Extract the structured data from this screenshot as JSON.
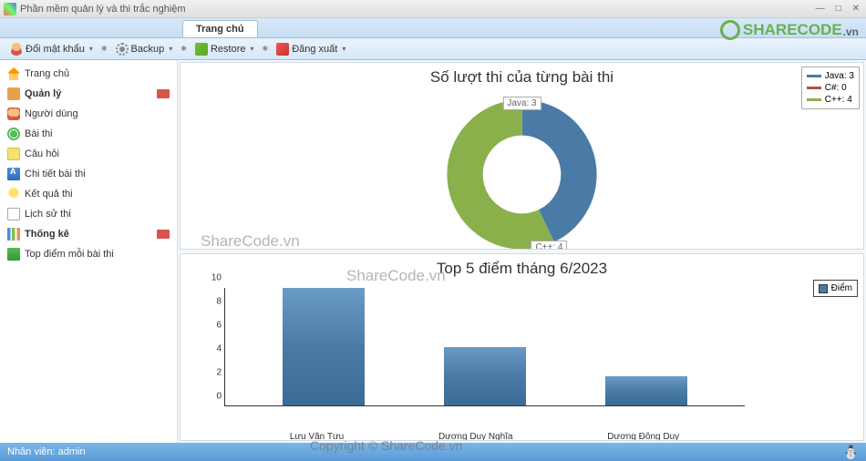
{
  "app_title": "Phần mềm quản lý và thi trắc nghiệm",
  "active_tab": "Trang chủ",
  "toolbar": {
    "change_pw": "Đổi mật khẩu",
    "backup": "Backup",
    "restore": "Restore",
    "logout": "Đăng xuất"
  },
  "sidebar": {
    "items": [
      {
        "label": "Trang chủ"
      },
      {
        "label": "Quản lý",
        "badge": true,
        "bold": true
      },
      {
        "label": "Người dùng"
      },
      {
        "label": "Bài thi"
      },
      {
        "label": "Câu hỏi"
      },
      {
        "label": "Chi tiết bài thi"
      },
      {
        "label": "Kết quả thi"
      },
      {
        "label": "Lịch sử thi"
      },
      {
        "label": "Thống kê",
        "badge": true,
        "bold": true
      },
      {
        "label": "Top điểm mỗi bài thi"
      }
    ]
  },
  "donut": {
    "title": "Số lượt thi của từng bài thi",
    "label_top": "Java: 3",
    "label_bot": "C++: 4",
    "legend": [
      {
        "name": "Java: 3",
        "color": "#4a7ba6"
      },
      {
        "name": "C#: 0",
        "color": "#b05050"
      },
      {
        "name": "C++: 4",
        "color": "#8ab04c"
      }
    ]
  },
  "bar": {
    "title": "Top 5 điểm tháng 6/2023",
    "legend_label": "Điểm",
    "y_ticks": [
      "0",
      "2",
      "4",
      "6",
      "8",
      "10"
    ]
  },
  "chart_data": [
    {
      "type": "pie",
      "title": "Số lượt thi của từng bài thi",
      "categories": [
        "Java",
        "C#",
        "C++"
      ],
      "values": [
        3,
        0,
        4
      ],
      "colors": [
        "#4a7ba6",
        "#b05050",
        "#8ab04c"
      ]
    },
    {
      "type": "bar",
      "title": "Top 5 điểm tháng 6/2023",
      "categories": [
        "Lưu Văn Tưu",
        "Dương Duy Nghĩa",
        "Dương Đông Duy"
      ],
      "values": [
        10,
        5,
        2.5
      ],
      "series_name": "Điểm",
      "ylim": [
        0,
        10
      ],
      "ylabel": "",
      "xlabel": ""
    }
  ],
  "status": "Nhân viên: admin",
  "watermarks": {
    "w1": "ShareCode.vn",
    "w2": "ShareCode.vn",
    "w3": "Copyright © ShareCode.vn"
  },
  "logo": {
    "t1": "SHARECODE",
    "t2": ".vn"
  }
}
